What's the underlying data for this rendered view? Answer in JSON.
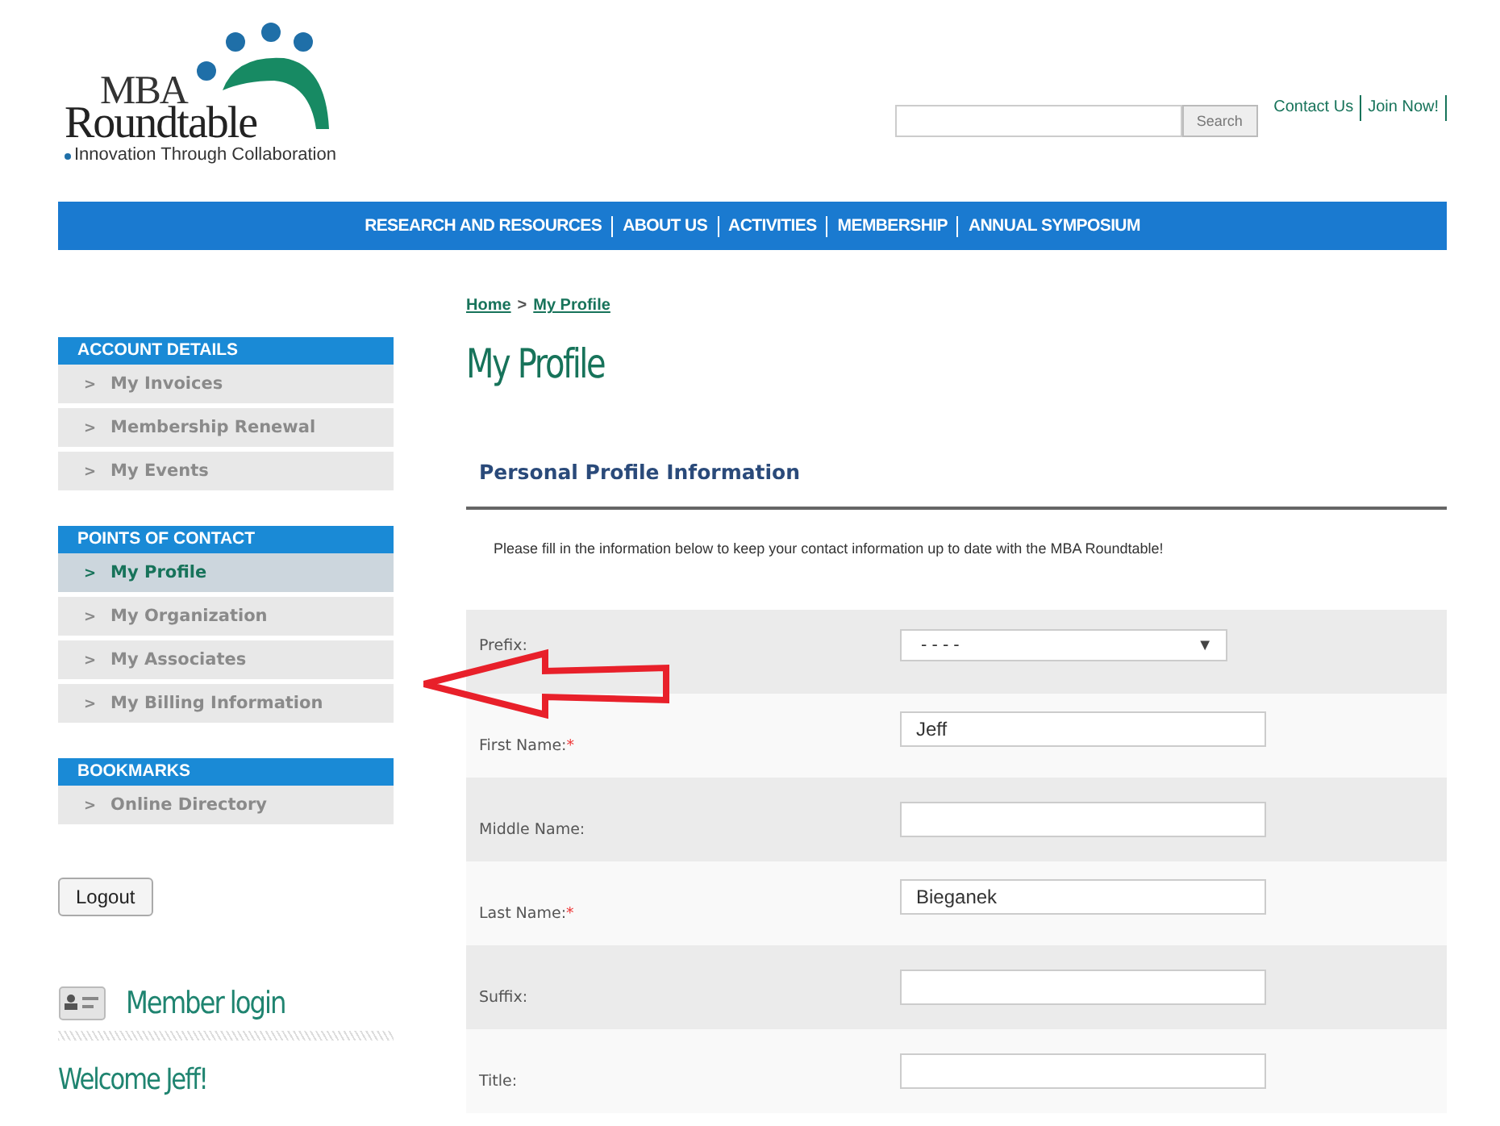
{
  "logo": {
    "line1": "MBA",
    "line2": "Roundtable",
    "tagline": "Innovation Through Collaboration"
  },
  "search": {
    "button": "Search"
  },
  "top_links": [
    "Contact Us",
    "Join Now!"
  ],
  "nav": [
    "RESEARCH AND RESOURCES",
    "ABOUT US",
    "ACTIVITIES",
    "MEMBERSHIP",
    "ANNUAL SYMPOSIUM"
  ],
  "sidebar": [
    {
      "title": "ACCOUNT DETAILS",
      "items": [
        {
          "label": "My Invoices",
          "selected": false
        },
        {
          "label": "Membership Renewal",
          "selected": false
        },
        {
          "label": "My Events",
          "selected": false
        }
      ]
    },
    {
      "title": "POINTS OF CONTACT",
      "items": [
        {
          "label": "My Profile",
          "selected": true
        },
        {
          "label": "My Organization",
          "selected": false
        },
        {
          "label": "My Associates",
          "selected": false
        },
        {
          "label": "My Billing Information",
          "selected": false
        }
      ]
    },
    {
      "title": "BOOKMARKS",
      "items": [
        {
          "label": "Online Directory",
          "selected": false
        }
      ]
    }
  ],
  "item_marker": ">",
  "logout": "Logout",
  "member_login": {
    "title": "Member login",
    "welcome": "Welcome Jeff!"
  },
  "breadcrumb": {
    "links": [
      "Home",
      "My Profile"
    ],
    "separator": ">"
  },
  "page_title": "My Profile",
  "section_title": "Personal Profile Information",
  "instructions": "Please fill in the information below to keep your contact information up to date with the MBA Roundtable!",
  "required_mark": "*",
  "select_caret": "▼",
  "form": [
    {
      "label": "Prefix:",
      "required": false,
      "kind": "select",
      "value": "- - - -"
    },
    {
      "label": "First Name:",
      "required": true,
      "kind": "text",
      "value": "Jeff"
    },
    {
      "label": "Middle Name:",
      "required": false,
      "kind": "text"
    },
    {
      "label": "Last Name:",
      "required": true,
      "kind": "text",
      "value": "Bieganek"
    },
    {
      "label": "Suffix:",
      "required": false,
      "kind": "text"
    },
    {
      "label": "Title:",
      "required": false,
      "kind": "text"
    }
  ]
}
